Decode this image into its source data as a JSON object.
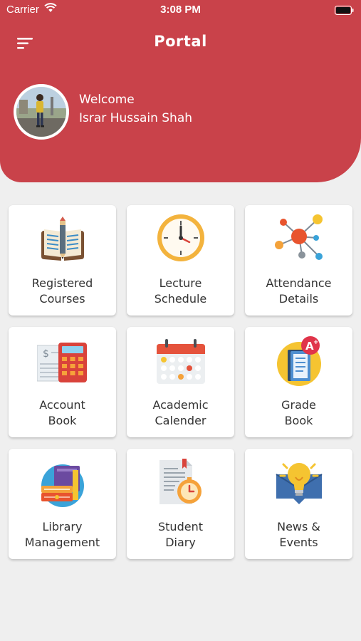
{
  "status_bar": {
    "carrier": "Carrier",
    "time": "3:08 PM"
  },
  "header": {
    "title": "Portal",
    "welcome_text": "Welcome",
    "user_name": "Israr Hussain Shah",
    "accent_color": "#c9424a"
  },
  "tiles": [
    {
      "line1": "Registered",
      "line2": "Courses",
      "icon": "book-pencil-icon"
    },
    {
      "line1": "Lecture",
      "line2": "Schedule",
      "icon": "clock-icon"
    },
    {
      "line1": "Attendance",
      "line2": "Details",
      "icon": "network-nodes-icon"
    },
    {
      "line1": "Account",
      "line2": "Book",
      "icon": "calculator-icon"
    },
    {
      "line1": "Academic",
      "line2": "Calender",
      "icon": "calendar-icon"
    },
    {
      "line1": "Grade",
      "line2": "Book",
      "icon": "grade-book-icon"
    },
    {
      "line1": "Library",
      "line2": "Management",
      "icon": "library-books-icon"
    },
    {
      "line1": "Student",
      "line2": "Diary",
      "icon": "diary-icon"
    },
    {
      "line1": "News &",
      "line2": "Events",
      "icon": "lightbulb-icon"
    }
  ]
}
